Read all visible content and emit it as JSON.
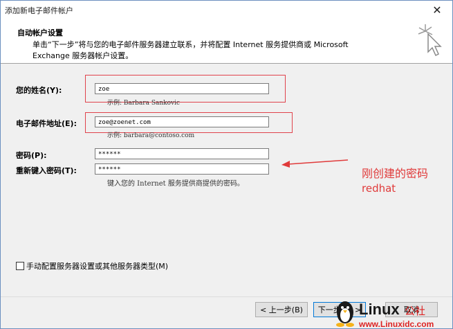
{
  "window": {
    "title": "添加新电子邮件帐户",
    "close_glyph": "✕"
  },
  "header": {
    "title": "自动帐户设置",
    "desc_line1": "单击“下一步”将与您的电子邮件服务器建立联系，并将配置 Internet 服务提供商或 Microsoft",
    "desc_line2": "Exchange 服务器帐户设置。",
    "icon": "cursor-click-icon"
  },
  "form": {
    "name_label": "您的姓名(Y):",
    "name_value": "zoe",
    "name_hint": "示例: Barbara Sankovic",
    "email_label": "电子邮件地址(E):",
    "email_value": "zoe@zoenet.com",
    "email_hint": "示例: barbara@contoso.com",
    "password_label": "密码(P):",
    "password_value": "******",
    "confirm_label": "重新键入密码(T):",
    "confirm_value": "******",
    "password_hint": "键入您的 Internet 服务提供商提供的密码。"
  },
  "annotation": {
    "line1": "刚创建的密码",
    "line2": "redhat",
    "color": "#e03a3a"
  },
  "manual_config": {
    "label": "手动配置服务器设置或其他服务器类型(M)",
    "checked": false
  },
  "buttons": {
    "back": "< 上一步(B)",
    "next": "下一步(N) >",
    "cancel": "取消"
  },
  "watermark": {
    "brand": "Linux",
    "suffix": "公社",
    "url": "www.Linuxidc.com"
  }
}
